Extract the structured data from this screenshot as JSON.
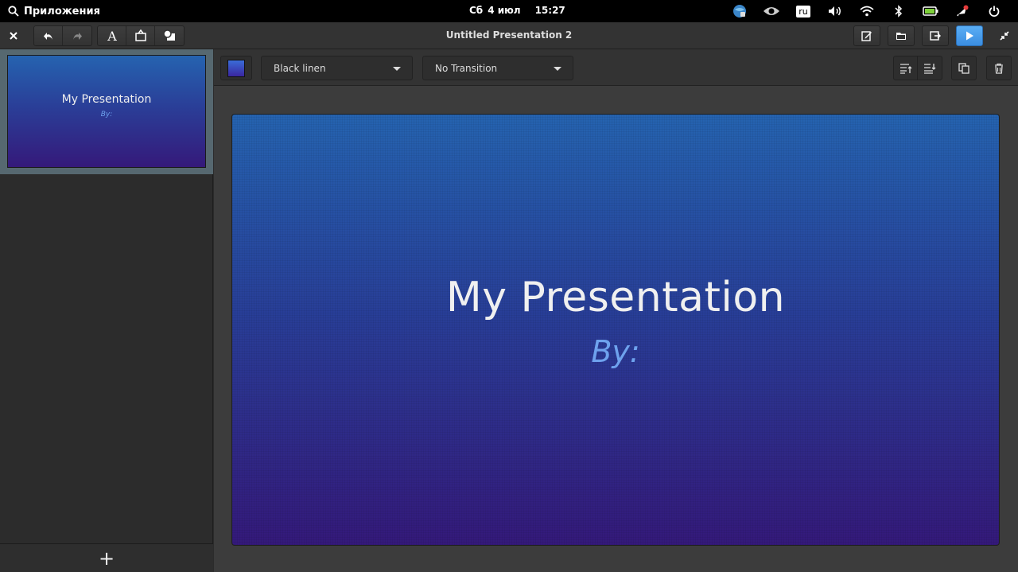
{
  "panel": {
    "apps_label": "Приложения",
    "day": "Сб",
    "date": "4 июл",
    "time": "15:27",
    "lang": "ru"
  },
  "header": {
    "title": "Untitled Presentation 2",
    "close_icon": "close-icon",
    "accent": "#3b8de0"
  },
  "toolbar": {
    "background_combo": "Black linen",
    "transition_combo": "No Transition"
  },
  "slides": [
    {
      "title": "My Presentation",
      "subtitle": "By:"
    }
  ],
  "slide": {
    "title": "My Presentation",
    "subtitle": "By:"
  },
  "sidebar": {
    "add_label": "+"
  }
}
